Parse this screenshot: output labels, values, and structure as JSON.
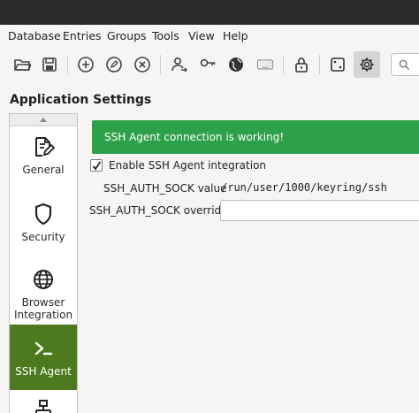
{
  "menubar": {
    "items": [
      "Database",
      "Entries",
      "Groups",
      "Tools",
      "View",
      "Help"
    ]
  },
  "toolbar": {
    "buttons": [
      {
        "icon": "open-database-icon"
      },
      {
        "icon": "save-database-icon"
      },
      {
        "icon": "add-entry-icon"
      },
      {
        "icon": "edit-entry-icon"
      },
      {
        "icon": "delete-entry-icon"
      },
      {
        "icon": "copy-username-icon"
      },
      {
        "icon": "copy-password-icon"
      },
      {
        "icon": "copy-url-icon"
      },
      {
        "icon": "auto-type-icon"
      },
      {
        "icon": "lock-database-icon"
      },
      {
        "icon": "password-generator-icon"
      },
      {
        "icon": "settings-icon",
        "active": true
      }
    ]
  },
  "page": {
    "title": "Application Settings"
  },
  "sidebar": {
    "items": [
      {
        "label": "General",
        "icon": "general-settings-icon"
      },
      {
        "label": "Security",
        "icon": "security-shield-icon"
      },
      {
        "label": "Browser\nIntegration",
        "icon": "globe-icon"
      },
      {
        "label": "SSH Agent",
        "icon": "terminal-icon",
        "selected": true
      },
      {
        "label": "",
        "icon": "network-icon"
      }
    ]
  },
  "ssh_agent": {
    "banner": "SSH Agent connection is working!",
    "enable_label": "Enable SSH Agent integration",
    "enable_checked": true,
    "auth_sock_label": "SSH_AUTH_SOCK value",
    "auth_sock_value": "/run/user/1000/keyring/ssh",
    "override_label": "SSH_AUTH_SOCK override",
    "override_value": ""
  },
  "colors": {
    "banner": "#2da04a",
    "selected_item": "#4d7a1e",
    "titlebar": "#2c2c2c"
  }
}
